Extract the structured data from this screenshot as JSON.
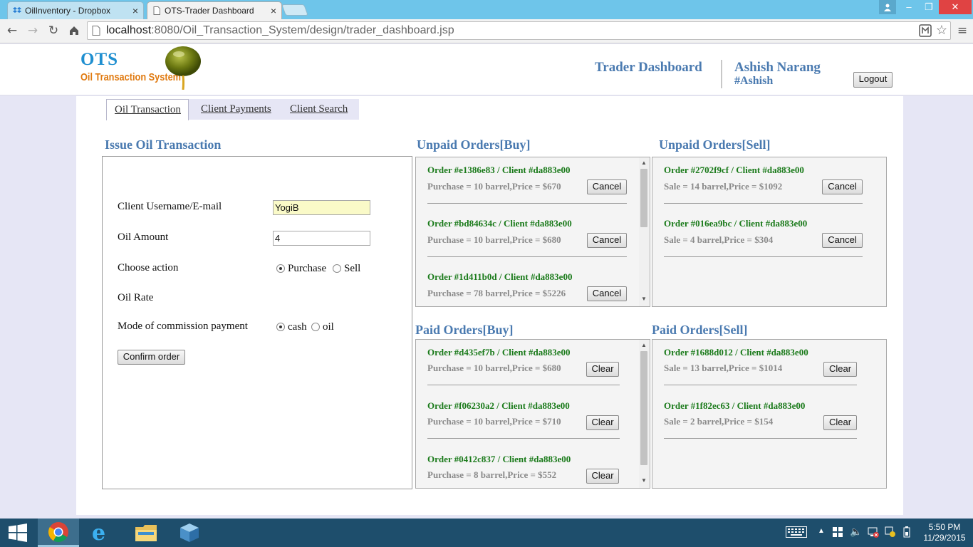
{
  "browser": {
    "tabs": [
      {
        "label": "OilInventory - Dropbox",
        "active": false,
        "icon": "dropbox-icon"
      },
      {
        "label": "OTS-Trader Dashboard",
        "active": true,
        "icon": "page-icon"
      }
    ],
    "url_host": "localhost",
    "url_path": ":8080/Oil_Transaction_System/design/trader_dashboard.jsp",
    "close_glyph": "×",
    "window_controls": {
      "minimize": "–",
      "maximize": "❐",
      "close": "✕"
    }
  },
  "header": {
    "logo_title": "OTS",
    "logo_subtitle": "Oil Transaction System",
    "dashboard_title": "Trader Dashboard",
    "user_name": "Ashish Narang",
    "user_handle": "#Ashish",
    "logout_label": "Logout"
  },
  "nav_tabs": [
    {
      "label": "Oil Transaction",
      "active": true
    },
    {
      "label": "Client Payments",
      "active": false
    },
    {
      "label": "Client Search",
      "active": false
    }
  ],
  "issue_form": {
    "title": "Issue Oil Transaction",
    "client_label": "Client Username/E-mail",
    "client_value": "YogiB",
    "amount_label": "Oil Amount",
    "amount_value": "4",
    "action_label": "Choose action",
    "action_options": [
      "Purchase",
      "Sell"
    ],
    "action_selected": "Purchase",
    "rate_label": "Oil Rate",
    "commission_label": "Mode of commission payment",
    "commission_options": [
      "cash",
      "oil"
    ],
    "commission_selected": "cash",
    "confirm_label": "Confirm order"
  },
  "unpaid_buy": {
    "title": "Unpaid Orders[Buy]",
    "button_label": "Cancel",
    "orders": [
      {
        "head": "Order #e1386e83 / Client #da883e00",
        "detail": "Purchase = 10 barrel,Price = $670"
      },
      {
        "head": "Order #bd84634c / Client #da883e00",
        "detail": "Purchase = 10 barrel,Price = $680"
      },
      {
        "head": "Order #1d411b0d / Client #da883e00",
        "detail": "Purchase = 78 barrel,Price = $5226"
      }
    ]
  },
  "unpaid_sell": {
    "title": "Unpaid Orders[Sell]",
    "button_label": "Cancel",
    "orders": [
      {
        "head": "Order #2702f9cf / Client #da883e00",
        "detail": "Sale = 14 barrel,Price = $1092"
      },
      {
        "head": "Order #016ea9bc / Client #da883e00",
        "detail": "Sale = 4 barrel,Price = $304"
      }
    ]
  },
  "paid_buy": {
    "title": "Paid Orders[Buy]",
    "button_label": "Clear",
    "orders": [
      {
        "head": "Order #d435ef7b / Client #da883e00",
        "detail": "Purchase = 10 barrel,Price = $680"
      },
      {
        "head": "Order #f06230a2 / Client #da883e00",
        "detail": "Purchase = 10 barrel,Price = $710"
      },
      {
        "head": "Order #0412c837 / Client #da883e00",
        "detail": "Purchase = 8 barrel,Price = $552"
      }
    ]
  },
  "paid_sell": {
    "title": "Paid Orders[Sell]",
    "button_label": "Clear",
    "orders": [
      {
        "head": "Order #1688d012 / Client #da883e00",
        "detail": "Sale = 13 barrel,Price = $1014"
      },
      {
        "head": "Order #1f82ec63 / Client #da883e00",
        "detail": "Sale = 2 barrel,Price = $154"
      }
    ]
  },
  "taskbar": {
    "time": "5:50 PM",
    "date": "11/29/2015",
    "apps": [
      "windows-start-icon",
      "chrome-icon",
      "internet-explorer-icon",
      "file-explorer-icon",
      "virtualbox-icon"
    ]
  },
  "colors": {
    "accent": "#4a7ab0",
    "order_head": "#1a7a1a",
    "order_detail": "#8a8a8a",
    "page_bg": "#e6e6f5",
    "taskbar": "#1e4e6c",
    "titlebar": "#6ec5ea"
  }
}
